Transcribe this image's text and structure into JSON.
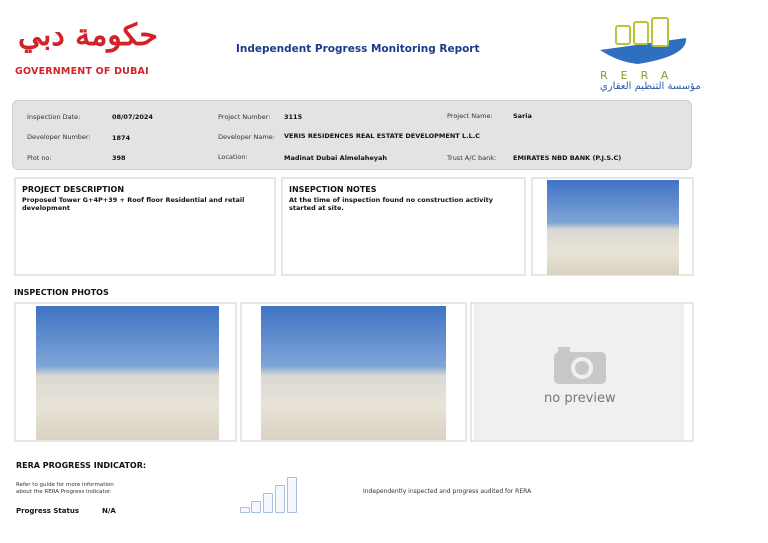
{
  "header": {
    "gov_logo_arabic": "حكومة دبي",
    "gov_logo_english": "GOVERNMENT OF DUBAI",
    "title": "Independent Progress Monitoring Report",
    "rera_logo_english": "RERA",
    "rera_logo_arabic": "مؤسسة التنظيم العقاري"
  },
  "info": {
    "inspection_date_label": "Inspection Date:",
    "inspection_date": "08/07/2024",
    "project_number_label": "Project Number:",
    "project_number": "3115",
    "project_name_label": "Project Name:",
    "project_name": "Saria",
    "developer_number_label": "Developer Number:",
    "developer_number": "1874",
    "developer_name_label": "Developer Name:",
    "developer_name": "VERIS RESIDENCES REAL ESTATE DEVELOPMENT L.L.C",
    "plot_label": "Plot no:",
    "plot": "398",
    "location_label": "Location:",
    "location": "Madinat Dubai Almelaheyah",
    "bank_label": "Trust A/C bank:",
    "bank": "EMIRATES NBD BANK  (P.J.S.C)"
  },
  "description": {
    "heading": "PROJECT DESCRIPTION",
    "text": "Proposed Tower G+4P+39 + Roof floor Residential and retail development"
  },
  "notes": {
    "heading": "INSEPCTION NOTES",
    "text": "At the time of inspection found no construction activity started at site."
  },
  "photos": {
    "heading": "INSPECTION PHOTOS",
    "no_preview": "no preview"
  },
  "indicator": {
    "heading": "RERA PROGRESS INDICATOR:",
    "guide": "Refer to guide for more information about the RERA Progress Indicator.",
    "status_label": "Progress Status",
    "status": "N/A",
    "audit_text": "Independently inspected and progress audited for RERA"
  }
}
